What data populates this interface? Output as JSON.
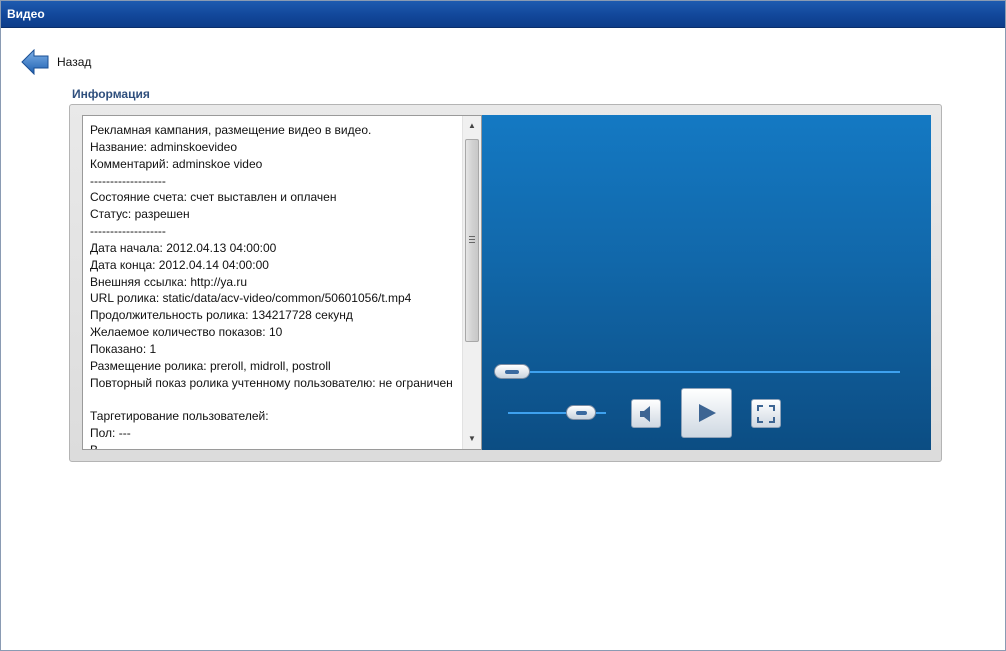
{
  "window": {
    "title": "Видео"
  },
  "nav": {
    "back_label": "Назад"
  },
  "info": {
    "title": "Информация",
    "lines": [
      "Рекламная кампания, размещение видео в видео.",
      "Название: adminskoevideo",
      "Комментарий: adminskoe video",
      "-------------------",
      "Состояние счета: счет выставлен и оплачен",
      "Статус: разрешен",
      "-------------------",
      "Дата начала: 2012.04.13 04:00:00",
      "Дата конца: 2012.04.14 04:00:00",
      "Внешняя ссылка: http://ya.ru",
      "URL ролика: static/data/acv-video/common/50601056/t.mp4",
      "Продолжительность ролика: 134217728 секунд",
      "Желаемое количество показов: 10",
      "Показано: 1",
      "Размещение ролика: preroll, midroll, postroll",
      "Повторный показ ролика учтенному пользователю: не ограничен",
      "",
      "Таргетирование пользователей:",
      "Пол: ---",
      "В"
    ]
  },
  "player": {
    "progress_fraction": 0.0,
    "volume_fraction": 0.75,
    "controls": [
      "mute-icon",
      "play-icon",
      "fullscreen-icon"
    ]
  },
  "colors": {
    "titlebar": "#12479a",
    "section_title": "#2f4f7d",
    "video_bg": "#1167a9",
    "slider_track": "#3ea1ef"
  }
}
